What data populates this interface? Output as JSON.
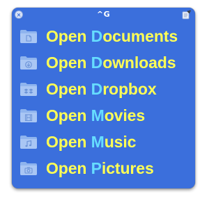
{
  "window": {
    "title": "^G",
    "close_icon": "close-icon",
    "settings_icon": "settings-icon"
  },
  "colors": {
    "panel_background": "#3b6fdc",
    "label_text": "#ffff55",
    "shortcut_key": "#66ddff",
    "folder_icon": "#8fb4ee"
  },
  "items": [
    {
      "prefix": "Open ",
      "key": "D",
      "rest": "ocuments",
      "icon": "documents-folder-icon"
    },
    {
      "prefix": "Open ",
      "key": "D",
      "rest": "ownloads",
      "icon": "downloads-folder-icon"
    },
    {
      "prefix": "Open ",
      "key": "D",
      "rest": "ropbox",
      "icon": "dropbox-folder-icon"
    },
    {
      "prefix": "Open ",
      "key": "M",
      "rest": "ovies",
      "icon": "movies-folder-icon"
    },
    {
      "prefix": "Open ",
      "key": "M",
      "rest": "usic",
      "icon": "music-folder-icon"
    },
    {
      "prefix": "Open ",
      "key": "P",
      "rest": "ictures",
      "icon": "pictures-folder-icon"
    }
  ]
}
